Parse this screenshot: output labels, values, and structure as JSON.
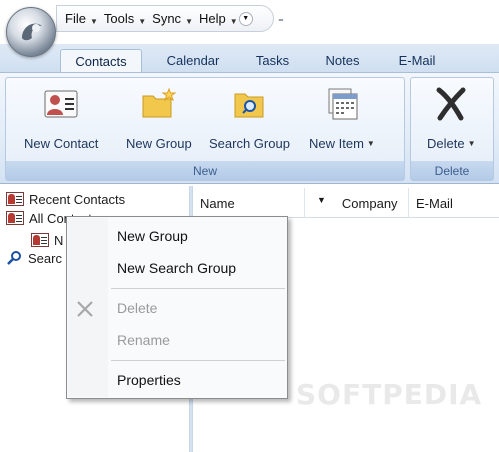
{
  "menu": {
    "items": [
      {
        "label": "File"
      },
      {
        "label": "Tools"
      },
      {
        "label": "Sync"
      },
      {
        "label": "Help"
      }
    ]
  },
  "tabs": [
    {
      "label": "Contacts",
      "active": true
    },
    {
      "label": "Calendar"
    },
    {
      "label": "Tasks"
    },
    {
      "label": "Notes"
    },
    {
      "label": "E-Mail"
    }
  ],
  "ribbon": {
    "groups": [
      {
        "label": "New",
        "buttons": [
          "New Contact",
          "New Group",
          "Search Group",
          "New Item"
        ]
      },
      {
        "label": "Delete",
        "buttons": [
          "Delete"
        ]
      }
    ]
  },
  "nav": {
    "items": [
      {
        "label": "Recent Contacts"
      },
      {
        "label": "All Contacts"
      },
      {
        "label": "N"
      },
      {
        "label": "Searc"
      }
    ]
  },
  "list": {
    "columns": [
      "Name",
      "Company",
      "E-Mail"
    ]
  },
  "context_menu": {
    "items": [
      {
        "label": "New Group",
        "enabled": true
      },
      {
        "label": "New Search Group",
        "enabled": true
      },
      {
        "label": "Delete",
        "enabled": false
      },
      {
        "label": "Rename",
        "enabled": false
      },
      {
        "label": "Properties",
        "enabled": true
      }
    ]
  },
  "watermark": "SOFTPEDIA",
  "colors": {
    "ribbon_bg": "#e2ecf8",
    "group_label_bg": "#b3cbe8",
    "tab_text": "#15325c",
    "disabled_text": "#9a9a9a"
  }
}
